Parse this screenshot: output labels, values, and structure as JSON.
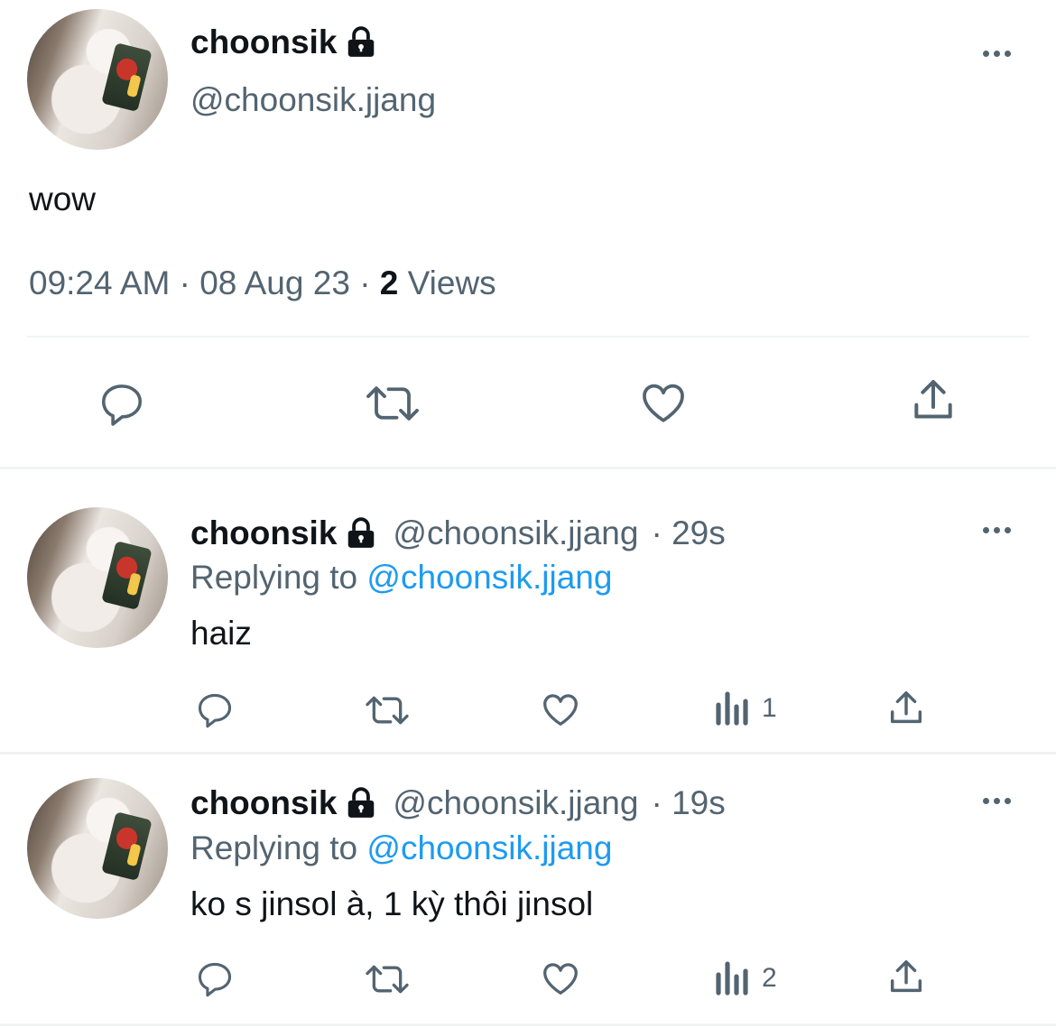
{
  "main_tweet": {
    "author_name": "choonsik",
    "handle": "@choonsik.jjang",
    "text": "wow",
    "time": "09:24 AM",
    "date": "08 Aug 23",
    "views_count": "2",
    "views_label": "Views",
    "separator": "·"
  },
  "replies": [
    {
      "author_name": "choonsik",
      "handle": "@choonsik.jjang",
      "time_ago": "· 29s",
      "replying_prefix": "Replying to",
      "replying_handle": "@choonsik.jjang",
      "text": "haiz",
      "views_count": "1"
    },
    {
      "author_name": "choonsik",
      "handle": "@choonsik.jjang",
      "time_ago": "· 19s",
      "replying_prefix": "Replying to",
      "replying_handle": "@choonsik.jjang",
      "text": "ko s jinsol à, 1 kỳ thôi jinsol",
      "views_count": "2"
    }
  ],
  "icons": [
    "lock-icon",
    "more-icon",
    "reply-icon",
    "retweet-icon",
    "like-icon",
    "share-icon",
    "views-icon"
  ],
  "colors": {
    "text": "#0f1419",
    "secondary": "#536471",
    "link": "#1d9bf0",
    "divider": "#eff3f4"
  }
}
